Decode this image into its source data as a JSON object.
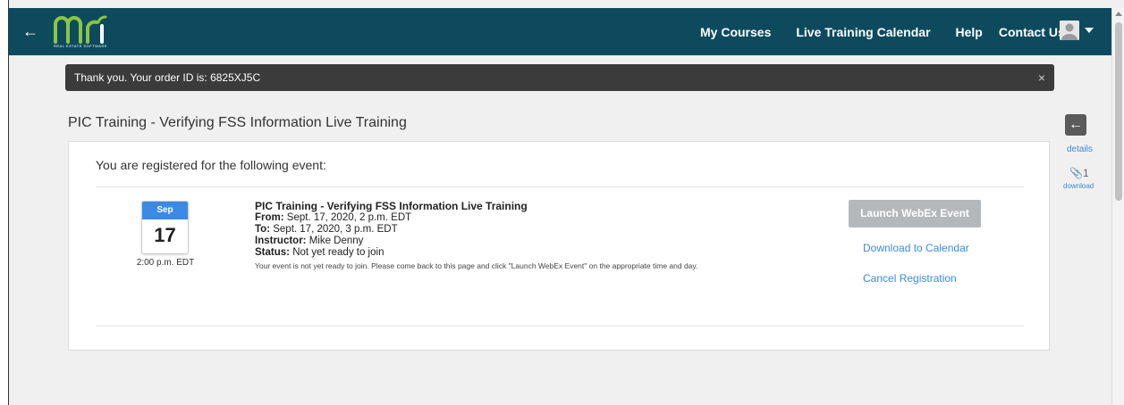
{
  "header": {
    "logo_text": "mri",
    "logo_subtext": "REAL ESTATE SOFTWARE",
    "nav": [
      "My Courses",
      "Live Training Calendar",
      "Help",
      "Contact Us"
    ]
  },
  "toast": {
    "message": "Thank you. Your order ID is: 6825XJ5C",
    "close": "×"
  },
  "page": {
    "title": "PIC Training - Verifying FSS Information Live Training"
  },
  "panel": {
    "heading": "You are registered for the following event:",
    "calendar": {
      "month": "Sep",
      "day": "17",
      "time": "2:00 p.m. EDT"
    },
    "event": {
      "title": "PIC Training - Verifying FSS Information Live Training",
      "from_label": "From:",
      "from_value": "Sept. 17, 2020, 2 p.m. EDT",
      "to_label": "To:",
      "to_value": "Sept. 17, 2020, 3 p.m. EDT",
      "instructor_label": "Instructor:",
      "instructor_value": "Mike Denny",
      "status_label": "Status:",
      "status_value": "Not yet ready to join",
      "note": "Your event is not yet ready to join. Please come back to this page and click \"Launch WebEx Event\" on the appropriate time and day."
    },
    "actions": {
      "launch": "Launch WebEx Event",
      "download_calendar": "Download to Calendar",
      "cancel": "Cancel Registration"
    }
  },
  "sidebar": {
    "details_label": "details",
    "attachment_count": "1",
    "download_label": "download"
  },
  "colors": {
    "topbar": "#0e4a5e",
    "accent": "#3b8ad9",
    "calendar_header": "#3b8ae6",
    "toast_bg": "#3b3b3b",
    "disabled_button": "#b5b8bb"
  }
}
